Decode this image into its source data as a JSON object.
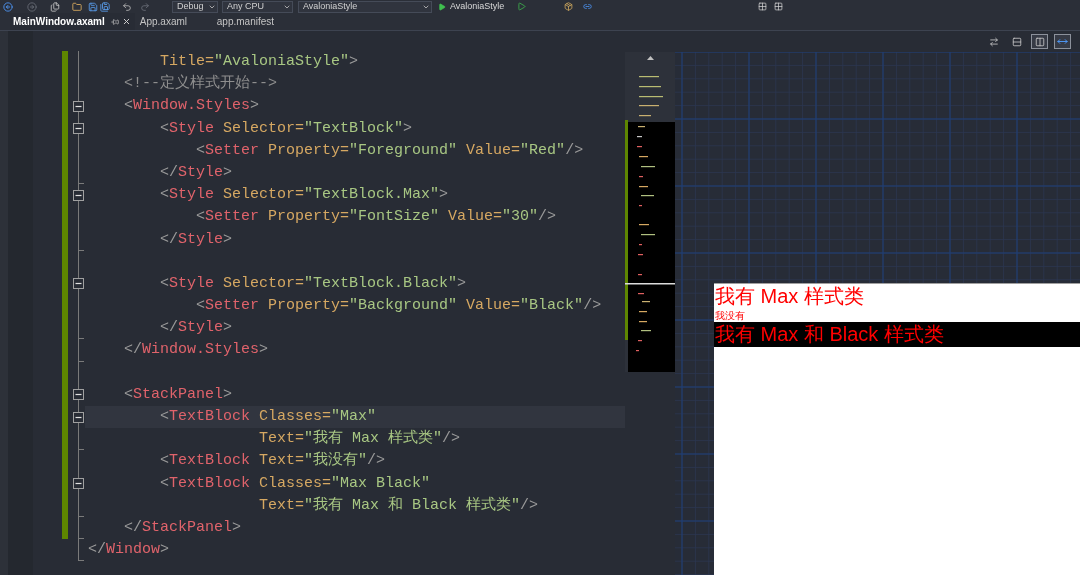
{
  "toolbar": {
    "configuration": "Debug",
    "platform": "Any CPU",
    "startup_project": "AvaloniaStyle",
    "run_target": "AvaloniaStyle"
  },
  "tabs": [
    {
      "label": "MainWindow.axaml",
      "selected": true
    },
    {
      "label": "App.axaml",
      "selected": false
    },
    {
      "label": "app.manifest",
      "selected": false
    }
  ],
  "editor": {
    "lines": [
      {
        "kind": "line",
        "tokens": [
          {
            "kind": "attribute",
            "text": "Title="
          },
          {
            "kind": "value",
            "text": "\"AvaloniaStyle\""
          },
          {
            "kind": "bracket",
            "text": ">"
          }
        ],
        "changed": true
      },
      {
        "kind": "line",
        "tokens": [
          {
            "kind": "comment",
            "text": "<!--定义样式开始-->"
          }
        ],
        "changed": true
      },
      {
        "kind": "opener",
        "expanded": true,
        "tokens": [
          {
            "kind": "bracket",
            "text": "<"
          },
          {
            "kind": "element",
            "text": "Window.Styles"
          },
          {
            "kind": "bracket",
            "text": ">"
          }
        ],
        "changed": true
      },
      {
        "kind": "opener",
        "expanded": true,
        "tokens": [
          {
            "kind": "bracket",
            "text": "<"
          },
          {
            "kind": "element",
            "text": "Style"
          },
          {
            "kind": "attribute",
            "text": " Selector="
          },
          {
            "kind": "value",
            "text": "\"TextBlock\""
          },
          {
            "kind": "bracket",
            "text": ">"
          }
        ],
        "changed": true
      },
      {
        "kind": "line",
        "tokens": [
          {
            "kind": "bracket",
            "text": "<"
          },
          {
            "kind": "element",
            "text": "Setter"
          },
          {
            "kind": "attribute",
            "text": " Property="
          },
          {
            "kind": "value",
            "text": "\"Foreground\""
          },
          {
            "kind": "attribute",
            "text": " Value="
          },
          {
            "kind": "value",
            "text": "\"Red\""
          },
          {
            "kind": "bracket",
            "text": "/>"
          }
        ],
        "changed": true
      },
      {
        "kind": "closer",
        "tokens": [
          {
            "kind": "bracket",
            "text": "</"
          },
          {
            "kind": "element",
            "text": "Style"
          },
          {
            "kind": "bracket",
            "text": ">"
          }
        ],
        "changed": true
      },
      {
        "kind": "opener",
        "expanded": true,
        "tokens": [
          {
            "kind": "bracket",
            "text": "<"
          },
          {
            "kind": "element",
            "text": "Style"
          },
          {
            "kind": "attribute",
            "text": " Selector="
          },
          {
            "kind": "value",
            "text": "\"TextBlock.Max\""
          },
          {
            "kind": "bracket",
            "text": ">"
          }
        ],
        "changed": true
      },
      {
        "kind": "line",
        "tokens": [
          {
            "kind": "bracket",
            "text": "<"
          },
          {
            "kind": "element",
            "text": "Setter"
          },
          {
            "kind": "attribute",
            "text": " Property="
          },
          {
            "kind": "value",
            "text": "\"FontSize\""
          },
          {
            "kind": "attribute",
            "text": " Value="
          },
          {
            "kind": "value",
            "text": "\"30\""
          },
          {
            "kind": "bracket",
            "text": "/>"
          }
        ],
        "changed": true
      },
      {
        "kind": "closer",
        "tokens": [
          {
            "kind": "bracket",
            "text": "</"
          },
          {
            "kind": "element",
            "text": "Style"
          },
          {
            "kind": "bracket",
            "text": ">"
          }
        ],
        "changed": true
      },
      {
        "kind": "line",
        "changed": true
      },
      {
        "kind": "opener",
        "expanded": true,
        "tokens": [
          {
            "kind": "bracket",
            "text": "<"
          },
          {
            "kind": "element",
            "text": "Style"
          },
          {
            "kind": "attribute",
            "text": " Selector="
          },
          {
            "kind": "value",
            "text": "\"TextBlock.Black\""
          },
          {
            "kind": "bracket",
            "text": ">"
          }
        ],
        "changed": true
      },
      {
        "kind": "line",
        "tokens": [
          {
            "kind": "bracket",
            "text": "<"
          },
          {
            "kind": "element",
            "text": "Setter"
          },
          {
            "kind": "attribute",
            "text": " Property="
          },
          {
            "kind": "value",
            "text": "\"Background\""
          },
          {
            "kind": "attribute",
            "text": " Value="
          },
          {
            "kind": "value",
            "text": "\"Black\""
          },
          {
            "kind": "bracket",
            "text": "/>"
          }
        ],
        "changed": true
      },
      {
        "kind": "closer",
        "tokens": [
          {
            "kind": "bracket",
            "text": "</"
          },
          {
            "kind": "element",
            "text": "Style"
          },
          {
            "kind": "bracket",
            "text": ">"
          }
        ],
        "changed": true
      },
      {
        "kind": "closer",
        "tokens": [
          {
            "kind": "bracket",
            "text": "</"
          },
          {
            "kind": "element",
            "text": "Window.Styles"
          },
          {
            "kind": "bracket",
            "text": ">"
          }
        ],
        "changed": true
      },
      {
        "kind": "line",
        "changed": true
      },
      {
        "kind": "opener",
        "expanded": true,
        "tokens": [
          {
            "kind": "bracket",
            "text": "<"
          },
          {
            "kind": "element",
            "text": "StackPanel"
          },
          {
            "kind": "bracket",
            "text": ">"
          }
        ],
        "changed": true
      },
      {
        "kind": "opener",
        "expanded": true,
        "tokens": [
          {
            "kind": "bracket",
            "text": "<"
          },
          {
            "kind": "element",
            "text": "TextBlock"
          },
          {
            "kind": "attribute",
            "text": " Classes="
          },
          {
            "kind": "value",
            "text": "\"Max\""
          }
        ],
        "changed": true,
        "current": true
      },
      {
        "kind": "closer",
        "tokens": [
          {
            "kind": "attribute",
            "text": "Text="
          },
          {
            "kind": "value",
            "text": "\"我有 Max 样式类\""
          },
          {
            "kind": "bracket",
            "text": "/>"
          }
        ],
        "changed": true
      },
      {
        "kind": "line",
        "tokens": [
          {
            "kind": "bracket",
            "text": "<"
          },
          {
            "kind": "element",
            "text": "TextBlock"
          },
          {
            "kind": "attribute",
            "text": " Text="
          },
          {
            "kind": "value",
            "text": "\"我没有\""
          },
          {
            "kind": "bracket",
            "text": "/>"
          }
        ],
        "changed": true
      },
      {
        "kind": "opener",
        "expanded": true,
        "tokens": [
          {
            "kind": "bracket",
            "text": "<"
          },
          {
            "kind": "element",
            "text": "TextBlock"
          },
          {
            "kind": "attribute",
            "text": " Classes="
          },
          {
            "kind": "value",
            "text": "\"Max Black\""
          }
        ],
        "changed": true
      },
      {
        "kind": "closer",
        "tokens": [
          {
            "kind": "attribute",
            "text": "Text="
          },
          {
            "kind": "value",
            "text": "\"我有 Max 和 Black 样式类\""
          },
          {
            "kind": "bracket",
            "text": "/>"
          }
        ],
        "changed": true
      },
      {
        "kind": "closer",
        "tokens": [
          {
            "kind": "bracket",
            "text": "</"
          },
          {
            "kind": "element",
            "text": "StackPanel"
          },
          {
            "kind": "bracket",
            "text": ">"
          }
        ],
        "changed": true
      },
      {
        "kind": "closer",
        "tokens": [
          {
            "kind": "bracket",
            "text": "</"
          },
          {
            "kind": "element",
            "text": "Window"
          },
          {
            "kind": "bracket",
            "text": ">"
          }
        ]
      }
    ]
  },
  "designer": {
    "view_buttons": [
      {
        "kind": "swap",
        "selected": false
      },
      {
        "kind": "rows",
        "selected": false
      },
      {
        "kind": "columns",
        "selected": true
      },
      {
        "kind": "fit",
        "selected": true
      }
    ],
    "preview": {
      "text_blocks": [
        {
          "text": "我有 Max 样式类",
          "large": true,
          "black_background": false
        },
        {
          "text": "我没有",
          "large": false,
          "black_background": false
        },
        {
          "text": "我有 Max 和 Black 样式类",
          "large": true,
          "black_background": true
        }
      ]
    }
  }
}
